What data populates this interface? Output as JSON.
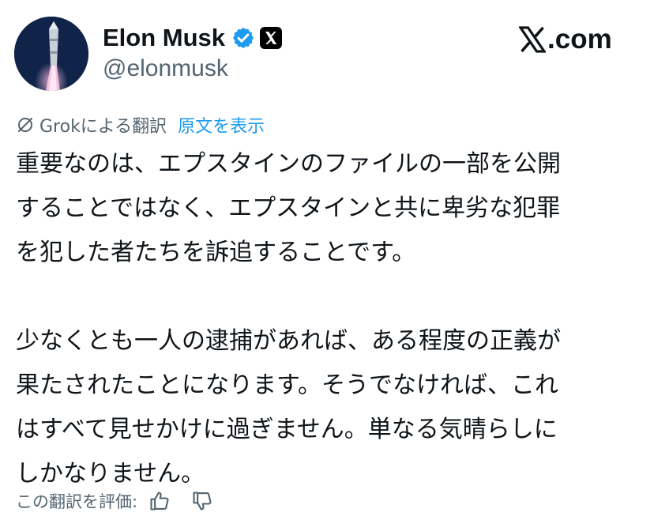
{
  "author": {
    "name": "Elon Musk",
    "handle": "@elonmusk",
    "verified_color": "#1d9bf0",
    "badge_icons": [
      "verified-checkmark-icon",
      "x-affiliate-badge-icon"
    ]
  },
  "site": {
    "logo_text": ".com",
    "logo_icon": "x-logo-icon"
  },
  "translation": {
    "label": "Grokによる翻訳",
    "show_original": "原文を表示",
    "icon": "grok-icon"
  },
  "post": {
    "paragraphs": [
      {
        "lines": [
          "重要なのは、エプスタインのファイルの一部を公開",
          "することではなく、エプスタインと共に卑劣な犯罪",
          "を犯した者たちを訴追することです。"
        ]
      },
      {
        "lines": [
          "少なくとも一人の逮捕があれば、ある程度の正義が",
          "果たされたことになります。そうでなければ、これ",
          "はすべて見せかけに過ぎません。単なる気晴らしに",
          "しかなりません。"
        ]
      }
    ]
  },
  "rating": {
    "label": "この翻訳を評価:",
    "icons": [
      "thumbs-up-icon",
      "thumbs-down-icon"
    ]
  },
  "colors": {
    "text_primary": "#0f1419",
    "text_secondary": "#536471",
    "link_blue": "#1d9bf0"
  }
}
